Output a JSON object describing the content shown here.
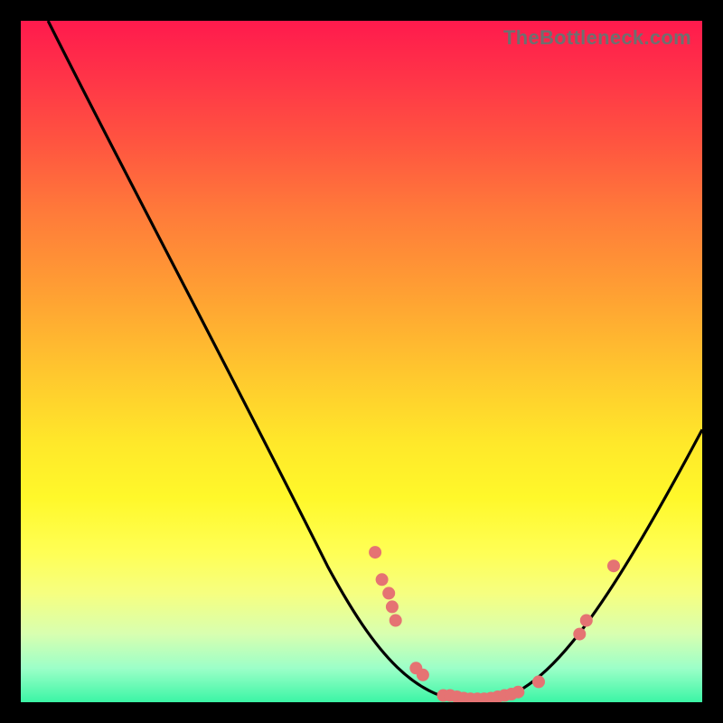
{
  "watermark": "TheBottleneck.com",
  "colors": {
    "dot": "#e57373",
    "curve": "#000000",
    "background": "#000000"
  },
  "chart_data": {
    "type": "line",
    "title": "",
    "xlabel": "",
    "ylabel": "",
    "xlim": [
      0,
      100
    ],
    "ylim": [
      0,
      100
    ],
    "grid": false,
    "legend": false,
    "curve": [
      {
        "x": 4,
        "y": 100
      },
      {
        "x": 20,
        "y": 70
      },
      {
        "x": 35,
        "y": 40
      },
      {
        "x": 48,
        "y": 16
      },
      {
        "x": 55,
        "y": 6
      },
      {
        "x": 62,
        "y": 0
      },
      {
        "x": 72,
        "y": 0
      },
      {
        "x": 78,
        "y": 3
      },
      {
        "x": 85,
        "y": 12
      },
      {
        "x": 92,
        "y": 24
      },
      {
        "x": 100,
        "y": 40
      }
    ],
    "points": [
      {
        "x": 52,
        "y": 22
      },
      {
        "x": 53,
        "y": 18
      },
      {
        "x": 54,
        "y": 16
      },
      {
        "x": 54.5,
        "y": 14
      },
      {
        "x": 55,
        "y": 12
      },
      {
        "x": 58,
        "y": 5
      },
      {
        "x": 59,
        "y": 4
      },
      {
        "x": 62,
        "y": 1
      },
      {
        "x": 63,
        "y": 1
      },
      {
        "x": 64,
        "y": 0.8
      },
      {
        "x": 65,
        "y": 0.6
      },
      {
        "x": 66,
        "y": 0.5
      },
      {
        "x": 67,
        "y": 0.5
      },
      {
        "x": 68,
        "y": 0.5
      },
      {
        "x": 69,
        "y": 0.6
      },
      {
        "x": 70,
        "y": 0.8
      },
      {
        "x": 71,
        "y": 1
      },
      {
        "x": 72,
        "y": 1.2
      },
      {
        "x": 73,
        "y": 1.5
      },
      {
        "x": 76,
        "y": 3
      },
      {
        "x": 82,
        "y": 10
      },
      {
        "x": 83,
        "y": 12
      },
      {
        "x": 87,
        "y": 20
      }
    ]
  }
}
